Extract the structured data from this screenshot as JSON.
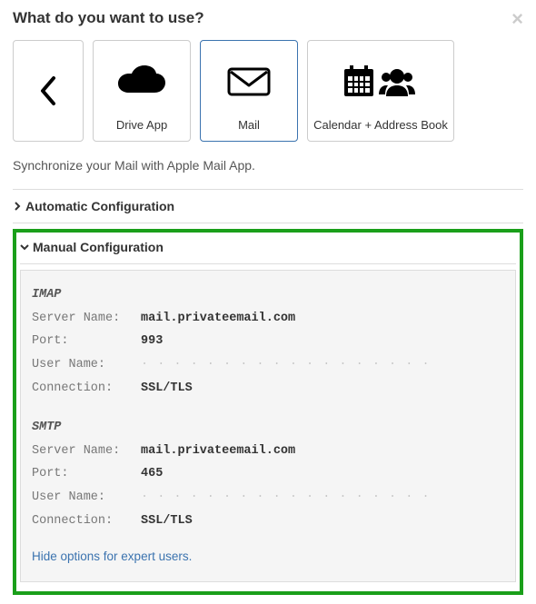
{
  "header": {
    "title": "What do you want to use?"
  },
  "cards": {
    "drive_label": "Drive App",
    "mail_label": "Mail",
    "cal_label": "Calendar + Address Book"
  },
  "description": "Synchronize your Mail with Apple Mail App.",
  "sections": {
    "auto_label": "Automatic Configuration",
    "manual_label": "Manual Configuration"
  },
  "config": {
    "imap": {
      "proto": "IMAP",
      "server_key": "Server Name:",
      "server_val": "mail.privateemail.com",
      "port_key": "Port:",
      "port_val": "993",
      "user_key": "User Name:",
      "user_val": "· · · · · · · · · · · · · · · · · ·",
      "conn_key": "Connection:",
      "conn_val": "SSL/TLS"
    },
    "smtp": {
      "proto": "SMTP",
      "server_key": "Server Name:",
      "server_val": "mail.privateemail.com",
      "port_key": "Port:",
      "port_val": "465",
      "user_key": "User Name:",
      "user_val": "· · · · · · · · · · · · · · · · · ·",
      "conn_key": "Connection:",
      "conn_val": "SSL/TLS"
    },
    "expert_link": "Hide options for expert users."
  }
}
